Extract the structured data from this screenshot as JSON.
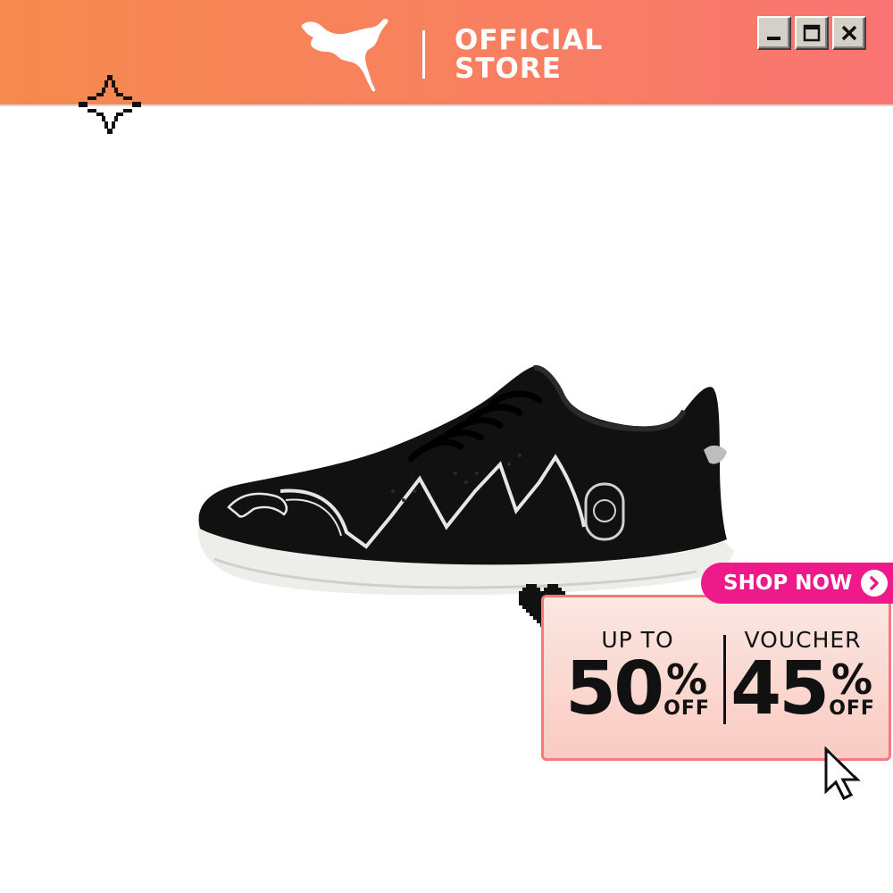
{
  "header": {
    "brand_logo": "puma-logo",
    "store_line1": "OFFICIAL",
    "store_line2": "STORE",
    "window_controls": [
      "minimize",
      "maximize",
      "close"
    ]
  },
  "product": {
    "image": "black-indoor-football-shoe"
  },
  "promo": {
    "left_label": "UP TO",
    "left_value": "50",
    "left_percent": "%",
    "left_suffix": "OFF",
    "right_label": "VOUCHER",
    "right_value": "45",
    "right_percent": "%",
    "right_suffix": "OFF"
  },
  "cta": {
    "label": "SHOP NOW"
  },
  "colors": {
    "header_gradient_start": "#f6894e",
    "header_gradient_end": "#f97473",
    "cta": "#ee1a8a",
    "promo_border": "#f47a7f",
    "promo_bg": "#f9cbc2"
  }
}
